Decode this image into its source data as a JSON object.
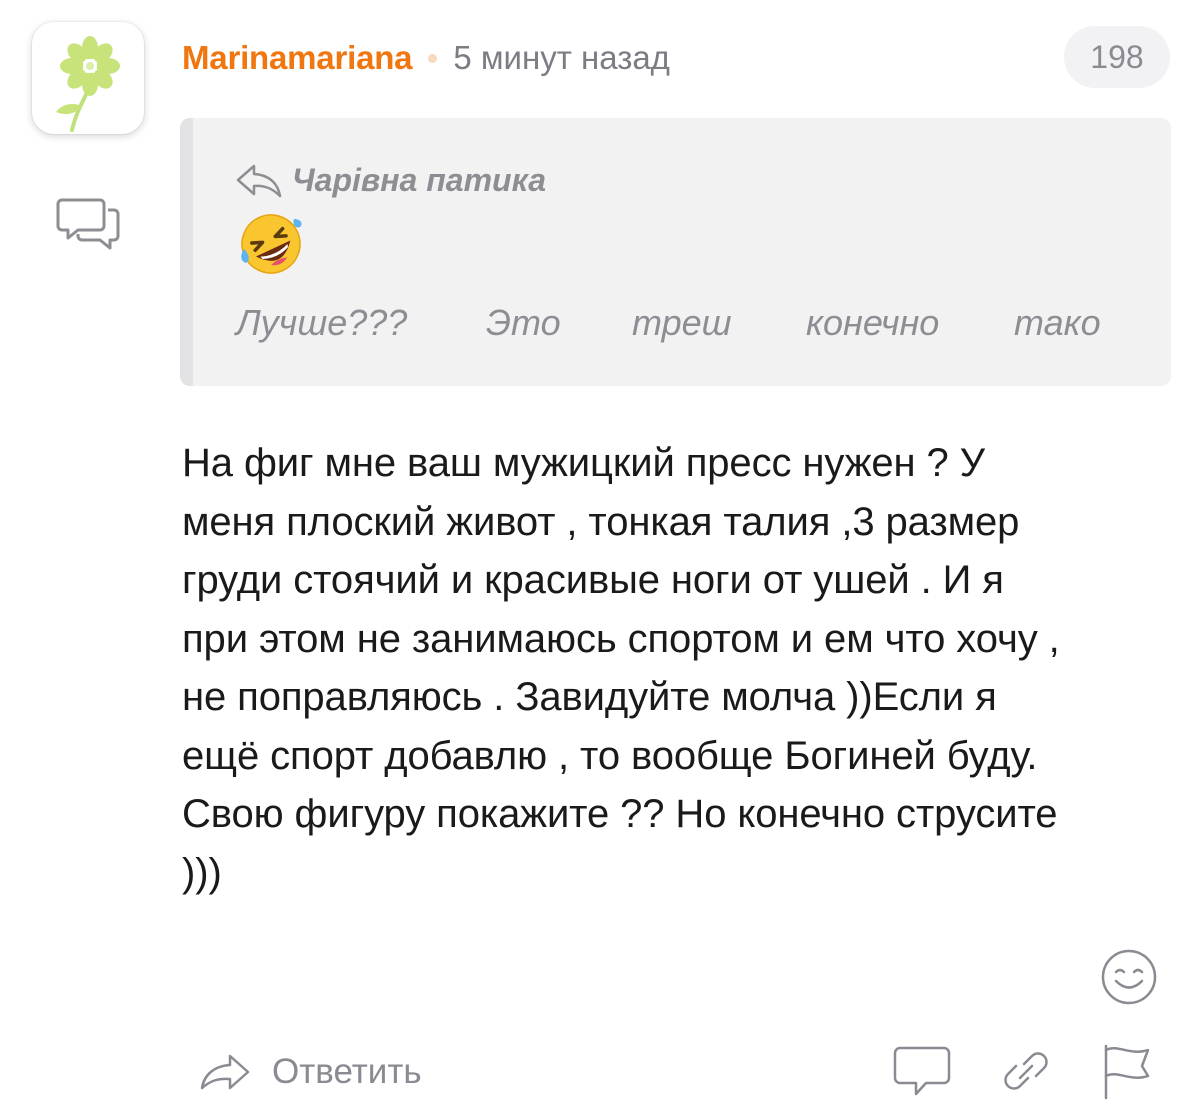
{
  "comment": {
    "author": "Marinamariana",
    "time": "5 минут назад",
    "count": "198",
    "quote": {
      "author": "Чарівна патика",
      "emoji": "rolling-on-floor-laughing",
      "words": [
        "Лучше???",
        "Это",
        "треш",
        "конечно",
        "тако"
      ]
    },
    "text_lines": [
      "На фиг мне ваш мужицкий пресс нужен ? У",
      "меня плоский живот , тонкая талия ,3 размер",
      "груди стоячий и красивые ноги от ушей . И я",
      "при этом не занимаюсь спортом и ем что хочу ,",
      "не поправляюсь . Завидуйте молча ))Если я",
      "ещё спорт добавлю , то вообще Богиней буду.",
      "Свою фигуру покажите ?? Но конечно струсите",
      ")))"
    ]
  },
  "actions": {
    "reply_label": "Ответить"
  },
  "icons": {
    "avatar": "green-flower-avatar",
    "side": "chat-bubbles-icon",
    "quote_reply": "reply-arrow-icon",
    "reaction": "smiley-face-icon",
    "reply": "reply-arrow-icon",
    "footer": [
      "chat-bubble-icon",
      "link-icon",
      "flag-icon"
    ]
  },
  "colors": {
    "author": "#f0760f",
    "muted_text": "#7c7c84",
    "quote_bg": "#f2f2f3",
    "icon_gray": "#8a8a92",
    "avatar_green": "#c7e37a"
  }
}
